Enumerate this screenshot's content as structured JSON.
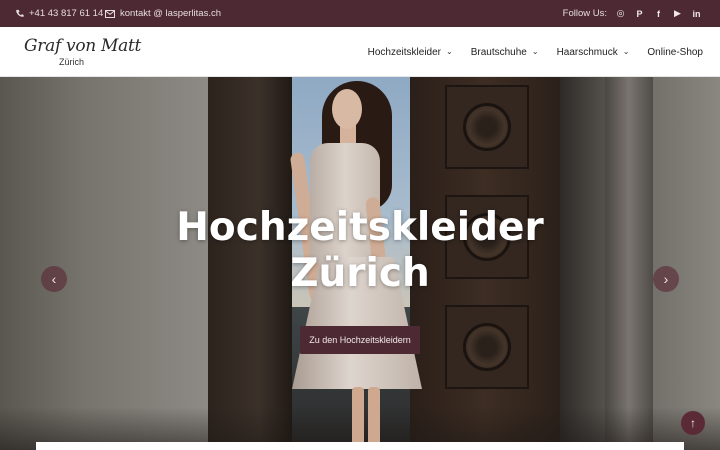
{
  "topbar": {
    "phone": "+41 43 817 61 14",
    "email": "kontakt @ lasperlitas.ch",
    "follow_label": "Follow Us:",
    "social": [
      {
        "icon": "instagram-icon",
        "glyph": "◎"
      },
      {
        "icon": "pinterest-icon",
        "glyph": "P"
      },
      {
        "icon": "facebook-icon",
        "glyph": "f"
      },
      {
        "icon": "youtube-icon",
        "glyph": "▶"
      },
      {
        "icon": "linkedin-icon",
        "glyph": "in"
      }
    ]
  },
  "header": {
    "logo_brand": "Graf von Matt",
    "logo_sub": "Zürich",
    "nav": [
      {
        "label": "Hochzeitskleider",
        "has_dropdown": true
      },
      {
        "label": "Brautschuhe",
        "has_dropdown": true
      },
      {
        "label": "Haarschmuck",
        "has_dropdown": true
      },
      {
        "label": "Online-Shop",
        "has_dropdown": false
      }
    ]
  },
  "hero": {
    "title_line1": "Hochzeitskleider",
    "title_line2": "Zürich",
    "cta_label": "Zu den Hochzeitskleidern",
    "prev_glyph": "‹",
    "next_glyph": "›"
  },
  "scroll_top_glyph": "↑",
  "colors": {
    "brand": "#4d2a33",
    "accent": "#5a2b36"
  }
}
